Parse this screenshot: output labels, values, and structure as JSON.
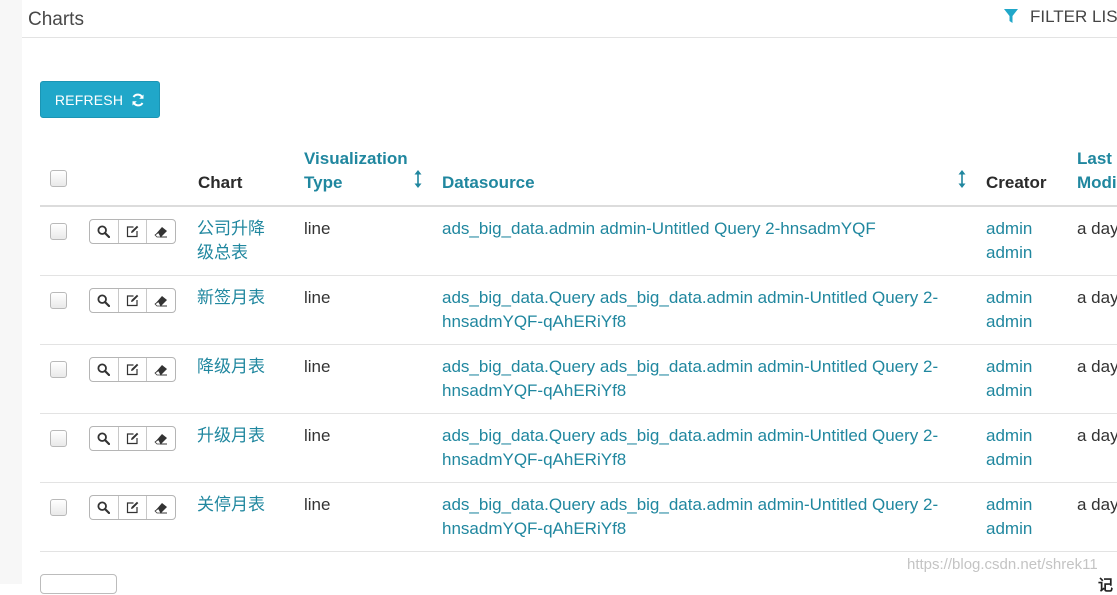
{
  "header": {
    "title": "Charts",
    "filter_label": "FILTER LIS"
  },
  "toolbar": {
    "refresh_label": "REFRESH"
  },
  "table": {
    "columns": {
      "chart": "Chart",
      "viz_type_line1": "Visualization",
      "viz_type_line2": "Type",
      "datasource": "Datasource",
      "creator": "Creator",
      "modified_line1": "Last",
      "modified_line2": "Modi"
    },
    "rows": [
      {
        "chart_line1": "公司升降",
        "chart_line2": "级总表",
        "viz_type": "line",
        "ds_line1": "ads_big_data.admin admin-Untitled Query 2-hnsadmYQF",
        "ds_line2": "",
        "creator_line1": "admin",
        "creator_line2": "admin",
        "modified": "a day"
      },
      {
        "chart_line1": "新签月表",
        "chart_line2": "",
        "viz_type": "line",
        "ds_line1": "ads_big_data.Query ads_big_data.admin admin-Untitled Query 2-",
        "ds_line2": "hnsadmYQF-qAhERiYf8",
        "creator_line1": "admin",
        "creator_line2": "admin",
        "modified": "a day"
      },
      {
        "chart_line1": "降级月表",
        "chart_line2": "",
        "viz_type": "line",
        "ds_line1": "ads_big_data.Query ads_big_data.admin admin-Untitled Query 2-",
        "ds_line2": "hnsadmYQF-qAhERiYf8",
        "creator_line1": "admin",
        "creator_line2": "admin",
        "modified": "a day"
      },
      {
        "chart_line1": "升级月表",
        "chart_line2": "",
        "viz_type": "line",
        "ds_line1": "ads_big_data.Query ads_big_data.admin admin-Untitled Query 2-",
        "ds_line2": "hnsadmYQF-qAhERiYf8",
        "creator_line1": "admin",
        "creator_line2": "admin",
        "modified": "a day"
      },
      {
        "chart_line1": "关停月表",
        "chart_line2": "",
        "viz_type": "line",
        "ds_line1": "ads_big_data.Query ads_big_data.admin admin-Untitled Query 2-",
        "ds_line2": "hnsadmYQF-qAhERiYf8",
        "creator_line1": "admin",
        "creator_line2": "admin",
        "modified": "a day"
      }
    ]
  },
  "footer": {
    "watermark": "https://blog.csdn.net/shrek11",
    "corner_char": "记"
  },
  "icons": {
    "filter": "filter-icon",
    "refresh": "refresh-icon",
    "sort": "sort-icon",
    "view": "search-icon",
    "edit": "edit-icon",
    "delete": "eraser-icon"
  },
  "colors": {
    "accent": "#20a7c9",
    "link": "#20879f",
    "text": "#333333"
  }
}
